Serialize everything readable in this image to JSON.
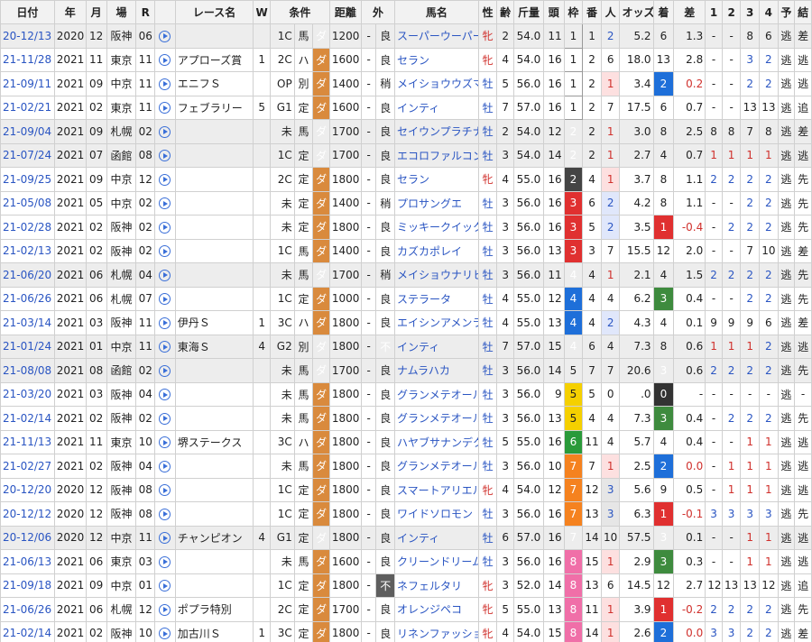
{
  "headers": [
    "日付",
    "年",
    "月",
    "場",
    "R",
    "",
    "レース名",
    "W",
    "条件",
    "",
    "",
    "距離",
    "外",
    "",
    "馬名",
    "性",
    "齢",
    "斤量",
    "頭",
    "枠",
    "番",
    "人",
    "オッズ",
    "着",
    "差",
    "1",
    "2",
    "3",
    "4",
    "予",
    "結"
  ],
  "rows": [
    {
      "date": "20-12/13",
      "y": "2020",
      "m": "12",
      "jo": "阪神",
      "r": "06",
      "race": "",
      "w": "",
      "cls": "1C",
      "kind": "馬",
      "surf": "ダ",
      "dist": "1200",
      "out": "-",
      "cond": "良",
      "horse": "スーパーウーパー",
      "sex": "牝",
      "age": "2",
      "kin": "54.0",
      "head": "11",
      "waku": "1",
      "ban": "1",
      "pop": "2",
      "odds": "5.2",
      "fin": "6",
      "diff": "1.3",
      "c1": "-",
      "c2": "-",
      "c3": "8",
      "c4": "6",
      "yo": "逃",
      "ke": "差"
    },
    {
      "date": "21-11/28",
      "y": "2021",
      "m": "11",
      "jo": "東京",
      "r": "11",
      "race": "アプローズ賞",
      "w": "1",
      "cls": "2C",
      "kind": "ハ",
      "surf": "ダ",
      "dist": "1600",
      "out": "-",
      "cond": "良",
      "horse": "セラン",
      "sex": "牝",
      "age": "4",
      "kin": "54.0",
      "head": "16",
      "waku": "1",
      "ban": "2",
      "pop": "6",
      "odds": "18.0",
      "fin": "13",
      "diff": "2.8",
      "c1": "-",
      "c2": "-",
      "c3": "3",
      "c4": "2",
      "yo": "逃",
      "ke": "逃"
    },
    {
      "date": "21-09/11",
      "y": "2021",
      "m": "09",
      "jo": "中京",
      "r": "11",
      "race": "エニフＳ",
      "w": "",
      "cls": "OP",
      "kind": "別",
      "surf": "ダ",
      "dist": "1400",
      "out": "-",
      "cond": "稍",
      "horse": "メイショウウズマサ",
      "sex": "牡",
      "age": "5",
      "kin": "56.0",
      "head": "16",
      "waku": "1",
      "ban": "2",
      "pop": "1",
      "odds": "3.4",
      "fin": "2",
      "diff": "0.2",
      "c1": "-",
      "c2": "-",
      "c3": "2",
      "c4": "2",
      "yo": "逃",
      "ke": "逃"
    },
    {
      "date": "21-02/21",
      "y": "2021",
      "m": "02",
      "jo": "東京",
      "r": "11",
      "race": "フェブラリー",
      "w": "5",
      "cls": "G1",
      "kind": "定",
      "surf": "ダ",
      "dist": "1600",
      "out": "-",
      "cond": "良",
      "horse": "インティ",
      "sex": "牡",
      "age": "7",
      "kin": "57.0",
      "head": "16",
      "waku": "1",
      "ban": "2",
      "pop": "7",
      "odds": "17.5",
      "fin": "6",
      "diff": "0.7",
      "c1": "-",
      "c2": "-",
      "c3": "13",
      "c4": "13",
      "yo": "逃",
      "ke": "追"
    },
    {
      "date": "21-09/04",
      "y": "2021",
      "m": "09",
      "jo": "札幌",
      "r": "02",
      "race": "",
      "w": "",
      "cls": "未",
      "kind": "馬",
      "surf": "ダ",
      "dist": "1700",
      "out": "-",
      "cond": "良",
      "horse": "セイウンプラチナ",
      "sex": "牡",
      "age": "2",
      "kin": "54.0",
      "head": "12",
      "waku": "2",
      "ban": "2",
      "pop": "1",
      "odds": "3.0",
      "fin": "8",
      "diff": "2.5",
      "c1": "8",
      "c2": "8",
      "c3": "7",
      "c4": "8",
      "yo": "逃",
      "ke": "差"
    },
    {
      "date": "21-07/24",
      "y": "2021",
      "m": "07",
      "jo": "函館",
      "r": "08",
      "race": "",
      "w": "",
      "cls": "1C",
      "kind": "定",
      "surf": "ダ",
      "dist": "1700",
      "out": "-",
      "cond": "良",
      "horse": "エコロファルコン",
      "sex": "牡",
      "age": "3",
      "kin": "54.0",
      "head": "14",
      "waku": "2",
      "ban": "2",
      "pop": "1",
      "odds": "2.7",
      "fin": "4",
      "diff": "0.7",
      "c1": "1",
      "c2": "1",
      "c3": "1",
      "c4": "1",
      "yo": "逃",
      "ke": "逃"
    },
    {
      "date": "21-09/25",
      "y": "2021",
      "m": "09",
      "jo": "中京",
      "r": "12",
      "race": "",
      "w": "",
      "cls": "2C",
      "kind": "定",
      "surf": "ダ",
      "dist": "1800",
      "out": "-",
      "cond": "良",
      "horse": "セラン",
      "sex": "牝",
      "age": "4",
      "kin": "55.0",
      "head": "16",
      "waku": "2",
      "ban": "4",
      "pop": "1",
      "odds": "3.7",
      "fin": "8",
      "diff": "1.1",
      "c1": "2",
      "c2": "2",
      "c3": "2",
      "c4": "2",
      "yo": "逃",
      "ke": "先"
    },
    {
      "date": "21-05/08",
      "y": "2021",
      "m": "05",
      "jo": "中京",
      "r": "02",
      "race": "",
      "w": "",
      "cls": "未",
      "kind": "定",
      "surf": "ダ",
      "dist": "1400",
      "out": "-",
      "cond": "稍",
      "horse": "プロサングエ",
      "sex": "牡",
      "age": "3",
      "kin": "56.0",
      "head": "16",
      "waku": "3",
      "ban": "6",
      "pop": "2",
      "odds": "4.2",
      "fin": "8",
      "diff": "1.1",
      "c1": "-",
      "c2": "-",
      "c3": "2",
      "c4": "2",
      "yo": "逃",
      "ke": "先"
    },
    {
      "date": "21-02/28",
      "y": "2021",
      "m": "02",
      "jo": "阪神",
      "r": "02",
      "race": "",
      "w": "",
      "cls": "未",
      "kind": "定",
      "surf": "ダ",
      "dist": "1800",
      "out": "-",
      "cond": "良",
      "horse": "ミッキークイック",
      "sex": "牡",
      "age": "3",
      "kin": "56.0",
      "head": "16",
      "waku": "3",
      "ban": "5",
      "pop": "2",
      "odds": "3.5",
      "fin": "1",
      "diff": "-0.4",
      "c1": "-",
      "c2": "2",
      "c3": "2",
      "c4": "2",
      "yo": "逃",
      "ke": "先"
    },
    {
      "date": "21-02/13",
      "y": "2021",
      "m": "02",
      "jo": "阪神",
      "r": "02",
      "race": "",
      "w": "",
      "cls": "1C",
      "kind": "馬",
      "surf": "ダ",
      "dist": "1400",
      "out": "-",
      "cond": "良",
      "horse": "カズカポレイ",
      "sex": "牡",
      "age": "3",
      "kin": "56.0",
      "head": "13",
      "waku": "3",
      "ban": "3",
      "pop": "7",
      "odds": "15.5",
      "fin": "12",
      "diff": "2.0",
      "c1": "-",
      "c2": "-",
      "c3": "7",
      "c4": "10",
      "yo": "逃",
      "ke": "差"
    },
    {
      "date": "21-06/20",
      "y": "2021",
      "m": "06",
      "jo": "札幌",
      "r": "04",
      "race": "",
      "w": "",
      "cls": "未",
      "kind": "馬",
      "surf": "ダ",
      "dist": "1700",
      "out": "-",
      "cond": "稍",
      "horse": "メイショウナリヒラ",
      "sex": "牡",
      "age": "3",
      "kin": "56.0",
      "head": "11",
      "waku": "4",
      "ban": "4",
      "pop": "1",
      "odds": "2.1",
      "fin": "4",
      "diff": "1.5",
      "c1": "2",
      "c2": "2",
      "c3": "2",
      "c4": "2",
      "yo": "逃",
      "ke": "先"
    },
    {
      "date": "21-06/26",
      "y": "2021",
      "m": "06",
      "jo": "札幌",
      "r": "07",
      "race": "",
      "w": "",
      "cls": "1C",
      "kind": "定",
      "surf": "ダ",
      "dist": "1000",
      "out": "-",
      "cond": "良",
      "horse": "ステラータ",
      "sex": "牡",
      "age": "4",
      "kin": "55.0",
      "head": "12",
      "waku": "4",
      "ban": "4",
      "pop": "4",
      "odds": "6.2",
      "fin": "3",
      "diff": "0.4",
      "c1": "-",
      "c2": "-",
      "c3": "2",
      "c4": "2",
      "yo": "逃",
      "ke": "先"
    },
    {
      "date": "21-03/14",
      "y": "2021",
      "m": "03",
      "jo": "阪神",
      "r": "11",
      "race": "伊丹Ｓ",
      "w": "1",
      "cls": "3C",
      "kind": "ハ",
      "surf": "ダ",
      "dist": "1800",
      "out": "-",
      "cond": "良",
      "horse": "エイシンアメンラー",
      "sex": "牡",
      "age": "4",
      "kin": "55.0",
      "head": "13",
      "waku": "4",
      "ban": "4",
      "pop": "2",
      "odds": "4.3",
      "fin": "4",
      "diff": "0.1",
      "c1": "9",
      "c2": "9",
      "c3": "9",
      "c4": "6",
      "yo": "逃",
      "ke": "差"
    },
    {
      "date": "21-01/24",
      "y": "2021",
      "m": "01",
      "jo": "中京",
      "r": "11",
      "race": "東海Ｓ",
      "w": "4",
      "cls": "G2",
      "kind": "別",
      "surf": "ダ",
      "dist": "1800",
      "out": "-",
      "cond": "不",
      "horse": "インティ",
      "sex": "牡",
      "age": "7",
      "kin": "57.0",
      "head": "15",
      "waku": "4",
      "ban": "6",
      "pop": "4",
      "odds": "7.3",
      "fin": "8",
      "diff": "0.6",
      "c1": "1",
      "c2": "1",
      "c3": "1",
      "c4": "2",
      "yo": "逃",
      "ke": "逃"
    },
    {
      "date": "21-08/08",
      "y": "2021",
      "m": "08",
      "jo": "函館",
      "r": "02",
      "race": "",
      "w": "",
      "cls": "未",
      "kind": "馬",
      "surf": "ダ",
      "dist": "1700",
      "out": "-",
      "cond": "良",
      "horse": "ナムラハカ",
      "sex": "牡",
      "age": "3",
      "kin": "56.0",
      "head": "14",
      "waku": "5",
      "ban": "7",
      "pop": "7",
      "odds": "20.6",
      "fin": "3",
      "diff": "0.6",
      "c1": "2",
      "c2": "2",
      "c3": "2",
      "c4": "2",
      "yo": "逃",
      "ke": "先"
    },
    {
      "date": "21-03/20",
      "y": "2021",
      "m": "03",
      "jo": "阪神",
      "r": "04",
      "race": "",
      "w": "",
      "cls": "未",
      "kind": "馬",
      "surf": "ダ",
      "dist": "1800",
      "out": "-",
      "cond": "良",
      "horse": "グランメテオール",
      "sex": "牡",
      "age": "3",
      "kin": "56.0",
      "head": "9",
      "waku": "5",
      "ban": "5",
      "pop": "0",
      "odds": ".0",
      "fin": "0",
      "diff": "-",
      "c1": "-",
      "c2": "-",
      "c3": "-",
      "c4": "-",
      "yo": "逃",
      "ke": "-"
    },
    {
      "date": "21-02/14",
      "y": "2021",
      "m": "02",
      "jo": "阪神",
      "r": "02",
      "race": "",
      "w": "",
      "cls": "未",
      "kind": "馬",
      "surf": "ダ",
      "dist": "1800",
      "out": "-",
      "cond": "良",
      "horse": "グランメテオール",
      "sex": "牡",
      "age": "3",
      "kin": "56.0",
      "head": "13",
      "waku": "5",
      "ban": "4",
      "pop": "4",
      "odds": "7.3",
      "fin": "3",
      "diff": "0.4",
      "c1": "-",
      "c2": "2",
      "c3": "2",
      "c4": "2",
      "yo": "逃",
      "ke": "先"
    },
    {
      "date": "21-11/13",
      "y": "2021",
      "m": "11",
      "jo": "東京",
      "r": "10",
      "race": "堺ステークス",
      "w": "",
      "cls": "3C",
      "kind": "ハ",
      "surf": "ダ",
      "dist": "1800",
      "out": "-",
      "cond": "良",
      "horse": "ハヤブサナンデクン",
      "sex": "牡",
      "age": "5",
      "kin": "55.0",
      "head": "16",
      "waku": "6",
      "ban": "11",
      "pop": "4",
      "odds": "5.7",
      "fin": "4",
      "diff": "0.4",
      "c1": "-",
      "c2": "-",
      "c3": "1",
      "c4": "1",
      "yo": "逃",
      "ke": "逃"
    },
    {
      "date": "21-02/27",
      "y": "2021",
      "m": "02",
      "jo": "阪神",
      "r": "04",
      "race": "",
      "w": "",
      "cls": "未",
      "kind": "馬",
      "surf": "ダ",
      "dist": "1800",
      "out": "-",
      "cond": "良",
      "horse": "グランメテオール",
      "sex": "牡",
      "age": "3",
      "kin": "56.0",
      "head": "10",
      "waku": "7",
      "ban": "7",
      "pop": "1",
      "odds": "2.5",
      "fin": "2",
      "diff": "0.0",
      "c1": "-",
      "c2": "1",
      "c3": "1",
      "c4": "1",
      "yo": "逃",
      "ke": "逃"
    },
    {
      "date": "20-12/20",
      "y": "2020",
      "m": "12",
      "jo": "阪神",
      "r": "08",
      "race": "",
      "w": "",
      "cls": "1C",
      "kind": "定",
      "surf": "ダ",
      "dist": "1800",
      "out": "-",
      "cond": "良",
      "horse": "スマートアリエル",
      "sex": "牝",
      "age": "4",
      "kin": "54.0",
      "head": "12",
      "waku": "7",
      "ban": "12",
      "pop": "3",
      "odds": "5.6",
      "fin": "9",
      "diff": "0.5",
      "c1": "-",
      "c2": "1",
      "c3": "1",
      "c4": "1",
      "yo": "逃",
      "ke": "逃"
    },
    {
      "date": "20-12/12",
      "y": "2020",
      "m": "12",
      "jo": "阪神",
      "r": "08",
      "race": "",
      "w": "",
      "cls": "1C",
      "kind": "定",
      "surf": "ダ",
      "dist": "1800",
      "out": "-",
      "cond": "良",
      "horse": "ワイドソロモン",
      "sex": "牡",
      "age": "3",
      "kin": "56.0",
      "head": "16",
      "waku": "7",
      "ban": "13",
      "pop": "3",
      "odds": "6.3",
      "fin": "1",
      "diff": "-0.1",
      "c1": "3",
      "c2": "3",
      "c3": "3",
      "c4": "3",
      "yo": "逃",
      "ke": "先"
    },
    {
      "date": "20-12/06",
      "y": "2020",
      "m": "12",
      "jo": "中京",
      "r": "11",
      "race": "チャンピオン",
      "w": "4",
      "cls": "G1",
      "kind": "定",
      "surf": "ダ",
      "dist": "1800",
      "out": "-",
      "cond": "良",
      "horse": "インティ",
      "sex": "牡",
      "age": "6",
      "kin": "57.0",
      "head": "16",
      "waku": "7",
      "ban": "14",
      "pop": "10",
      "odds": "57.5",
      "fin": "3",
      "diff": "0.1",
      "c1": "-",
      "c2": "-",
      "c3": "1",
      "c4": "1",
      "yo": "逃",
      "ke": "逃"
    },
    {
      "date": "21-06/13",
      "y": "2021",
      "m": "06",
      "jo": "東京",
      "r": "03",
      "race": "",
      "w": "",
      "cls": "未",
      "kind": "馬",
      "surf": "ダ",
      "dist": "1600",
      "out": "-",
      "cond": "良",
      "horse": "クリーンドリーム",
      "sex": "牡",
      "age": "3",
      "kin": "56.0",
      "head": "16",
      "waku": "8",
      "ban": "15",
      "pop": "1",
      "odds": "2.9",
      "fin": "3",
      "diff": "0.3",
      "c1": "-",
      "c2": "-",
      "c3": "1",
      "c4": "1",
      "yo": "逃",
      "ke": "逃"
    },
    {
      "date": "21-09/18",
      "y": "2021",
      "m": "09",
      "jo": "中京",
      "r": "01",
      "race": "",
      "w": "",
      "cls": "1C",
      "kind": "定",
      "surf": "ダ",
      "dist": "1800",
      "out": "-",
      "cond": "不",
      "horse": "ネフェルタリ",
      "sex": "牝",
      "age": "3",
      "kin": "52.0",
      "head": "14",
      "waku": "8",
      "ban": "13",
      "pop": "6",
      "odds": "14.5",
      "fin": "12",
      "diff": "2.7",
      "c1": "12",
      "c2": "13",
      "c3": "13",
      "c4": "12",
      "yo": "逃",
      "ke": "追"
    },
    {
      "date": "21-06/26",
      "y": "2021",
      "m": "06",
      "jo": "札幌",
      "r": "12",
      "race": "ポプラ特別",
      "w": "",
      "cls": "2C",
      "kind": "定",
      "surf": "ダ",
      "dist": "1700",
      "out": "-",
      "cond": "良",
      "horse": "オレンジペコ",
      "sex": "牝",
      "age": "5",
      "kin": "55.0",
      "head": "13",
      "waku": "8",
      "ban": "11",
      "pop": "1",
      "odds": "3.9",
      "fin": "1",
      "diff": "-0.2",
      "c1": "2",
      "c2": "2",
      "c3": "2",
      "c4": "2",
      "yo": "逃",
      "ke": "先"
    },
    {
      "date": "21-02/14",
      "y": "2021",
      "m": "02",
      "jo": "阪神",
      "r": "10",
      "race": "加古川Ｓ",
      "w": "1",
      "cls": "3C",
      "kind": "定",
      "surf": "ダ",
      "dist": "1800",
      "out": "-",
      "cond": "良",
      "horse": "リネンファッション",
      "sex": "牝",
      "age": "4",
      "kin": "54.0",
      "head": "15",
      "waku": "8",
      "ban": "14",
      "pop": "1",
      "odds": "2.6",
      "fin": "2",
      "diff": "0.0",
      "c1": "3",
      "c2": "3",
      "c3": "2",
      "c4": "2",
      "yo": "逃",
      "ke": "差"
    }
  ]
}
